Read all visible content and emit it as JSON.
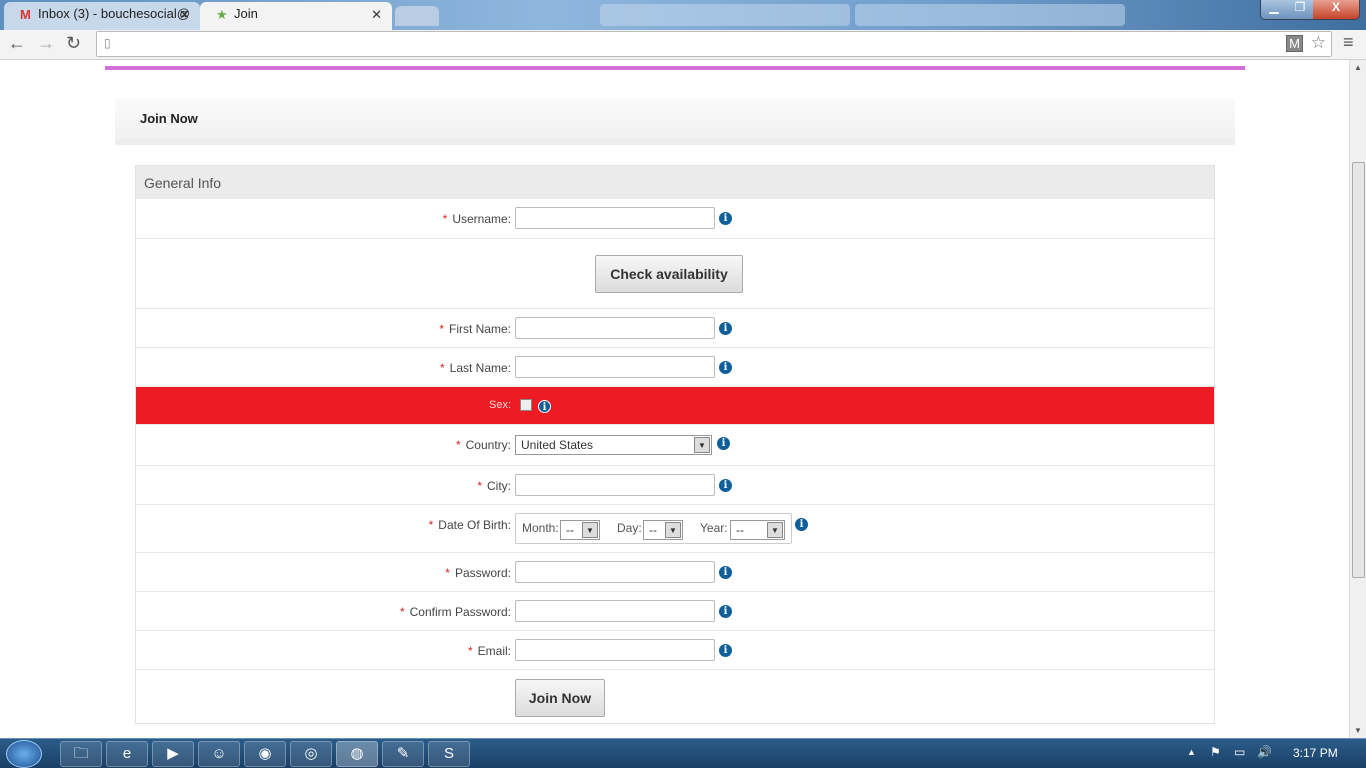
{
  "browser": {
    "tabs": [
      {
        "label": "Inbox (3) - bouchesocial@",
        "icon": "gmail-icon"
      },
      {
        "label": "Join",
        "icon": "star-favicon-icon"
      }
    ],
    "address": ""
  },
  "page": {
    "title": "Join Now",
    "section": "General Info",
    "fields": {
      "username": "Username:",
      "check": "Check availability",
      "first": "First Name:",
      "last": "Last Name:",
      "sex": "Sex:",
      "country": "Country:",
      "country_value": "United States",
      "city": "City:",
      "dob": "Date Of Birth:",
      "month": "Month:",
      "day": "Day:",
      "year": "Year:",
      "dash": "--",
      "password": "Password:",
      "confirm": "Confirm Password:",
      "email": "Email:"
    },
    "required_mark": "*",
    "submit": "Join Now",
    "error_color": "#ed1c24"
  },
  "taskbar": {
    "time": "3:17 PM"
  }
}
